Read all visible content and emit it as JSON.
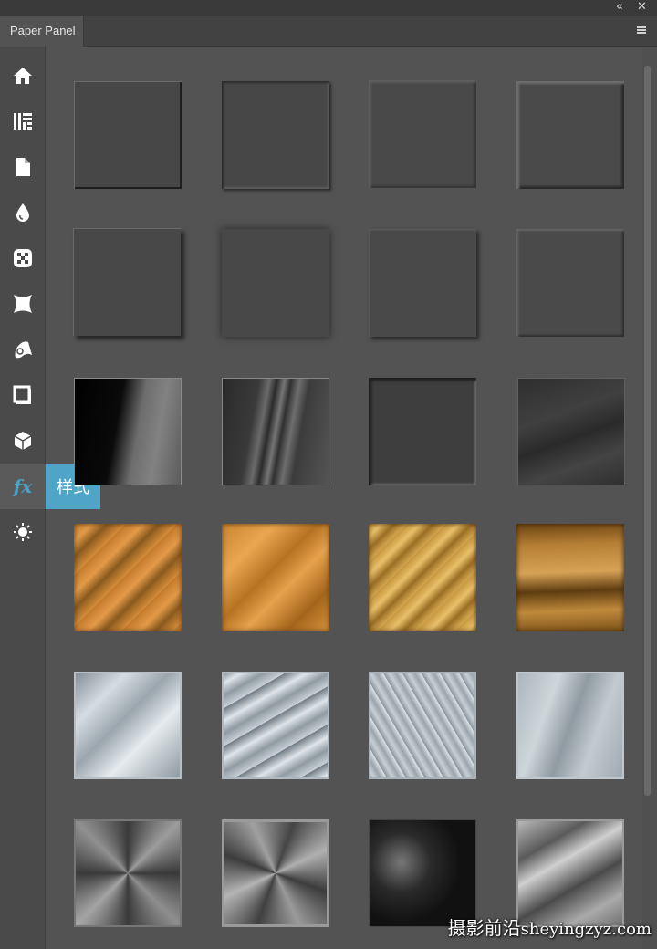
{
  "window": {
    "collapse_glyph": "«",
    "close_glyph": "✕"
  },
  "panel": {
    "tab_label": "Paper Panel",
    "menu_icon": "hamburger-menu-icon"
  },
  "sidebar": {
    "items": [
      {
        "name": "home",
        "icon": "home-icon"
      },
      {
        "name": "patterns",
        "icon": "pattern-grid-icon"
      },
      {
        "name": "paper",
        "icon": "document-icon"
      },
      {
        "name": "ink",
        "icon": "drop-icon"
      },
      {
        "name": "textures",
        "icon": "checker-icon"
      },
      {
        "name": "warp",
        "icon": "warp-shape-icon"
      },
      {
        "name": "roll",
        "icon": "scroll-icon"
      },
      {
        "name": "frame",
        "icon": "frame-icon"
      },
      {
        "name": "3d",
        "icon": "cube-icon"
      },
      {
        "name": "styles",
        "icon": "fx-icon",
        "glyph": "fx",
        "active": true
      },
      {
        "name": "light",
        "icon": "sun-icon"
      }
    ],
    "tooltip": "样式"
  },
  "styles_grid": {
    "rows": [
      [
        "bevel-dark-1",
        "bevel-dark-2",
        "bevel-dark-3",
        "bevel-dark-4"
      ],
      [
        "shadow-dark-1",
        "shadow-dark-2",
        "shadow-dark-3",
        "shadow-dark-4"
      ],
      [
        "black-gloss",
        "black-streak",
        "dark-inset",
        "dark-silk"
      ],
      [
        "gold-mottled",
        "gold-diagonal",
        "gold-stripe",
        "gold-brushed"
      ],
      [
        "silver-crumple",
        "silver-wave",
        "silver-foil",
        "silver-satin"
      ],
      [
        "steel-radial",
        "steel-radial-2",
        "dark-rock",
        "chrome-fold"
      ]
    ]
  },
  "colors": {
    "accent": "#4ea5c8",
    "panel_bg": "#535353",
    "sidebar_bg": "#4a4a4a"
  },
  "watermark": {
    "cjk": "摄影前沿",
    "latin": "sheyingzyz.com"
  }
}
